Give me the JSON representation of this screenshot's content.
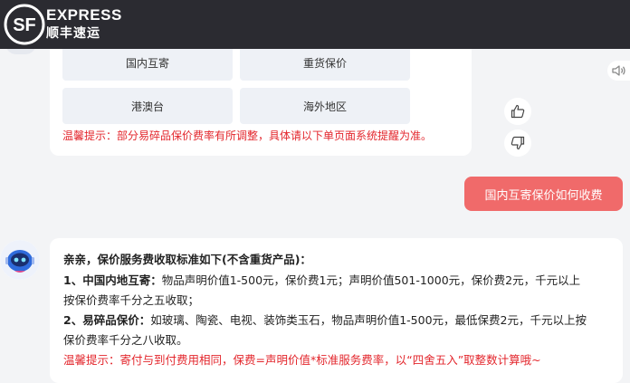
{
  "header": {
    "brand_en": "EXPRESS",
    "brand_cn": "顺丰速运",
    "logo_text": "SF"
  },
  "services": [
    {
      "label": "国内互寄"
    },
    {
      "label": "重货保价"
    },
    {
      "label": "港澳台"
    },
    {
      "label": "海外地区"
    }
  ],
  "tip1": "温馨提示：部分易碎品保价费率有所调整，具体请以下单页面系统提醒为准。",
  "user_message": "国内互寄保价如何收费",
  "reply": {
    "title": "亲亲，保价服务费收取标准如下(不含重货产品)：",
    "item1_label": "1、中国内地互寄：",
    "item1_text": "物品声明价值1-500元，保价费1元；声明价值501-1000元，保价费2元，千元以上",
    "item1_cont": "按保价费率千分之五收取；",
    "item2_label": "2、易碎品保价：",
    "item2_text": "如玻璃、陶瓷、电视、装饰类玉石，物品声明价值1-500元，最低保费2元，千元以上按",
    "item2_cont": "保价费率千分之八收取。",
    "tip": "温馨提示：寄付与到付费用相同，保费=声明价值*标准服务费率，以“四舍五入”取整数计算哦~"
  },
  "colors": {
    "header_bg": "#2b2b31",
    "accent_red": "#e3262c",
    "user_bubble": "#f06a6a",
    "button_bg": "#eef1f6"
  },
  "icons": [
    "sf-logo-icon",
    "speaker-icon",
    "thumbs-up-icon",
    "thumbs-down-icon",
    "robot-avatar-icon"
  ]
}
